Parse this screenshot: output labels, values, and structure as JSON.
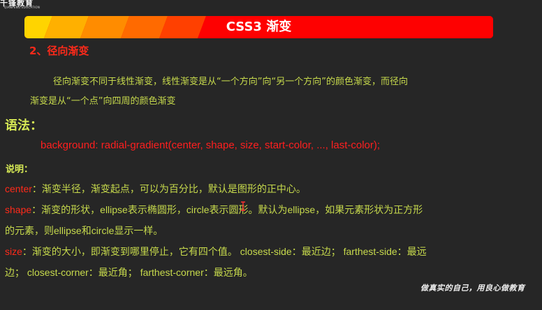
{
  "brand": {
    "logo_text": "千锋教育",
    "logo_subtext": "QIANFENG EDUCATION"
  },
  "title_bar": {
    "title": "CSS3 渐变",
    "colors": [
      "#ffd700",
      "#ffb300",
      "#ff8c00",
      "#ff6a00",
      "#ff4500",
      "#fe0101"
    ]
  },
  "section": {
    "heading": "2、径向渐变"
  },
  "intro": {
    "line1": "径向渐变不同于线性渐变，线性渐变是从“一个方向”向“另一个方向”的颜色渐变，而径向",
    "line2": "渐变是从“一个点”向四周的颜色渐变"
  },
  "syntax": {
    "label": "语法：",
    "code": "background: radial-gradient(center, shape, size, start-color, ..., last-color);"
  },
  "notes": {
    "label": "说明：",
    "center_key": "center",
    "center_desc": "：渐变半径，渐变起点，可以为百分比，默认是图形的正中心。",
    "shape_key": "shape",
    "shape_desc_1": "：渐变的形状，ellipse表示椭圆形，circle表示圆形。默认为ellipse，如果元素形状为正方形",
    "shape_desc_2": "的元素，则ellipse和circle显示一样。",
    "size_key": "size",
    "size_desc_1": "：渐变的大小，即渐变到哪里停止，它有四个值。 closest-side：最近边； farthest-side：最远",
    "size_desc_2": "边； closest-corner：最近角； farthest-corner：最远角。"
  },
  "footer": {
    "motto": "做真实的自己，用良心做教育"
  },
  "colors": {
    "background": "#262626",
    "accent_red": "#ff2a1a",
    "text_green": "#c7da4c"
  },
  "icons": {
    "cursor": "text-cursor-icon"
  }
}
